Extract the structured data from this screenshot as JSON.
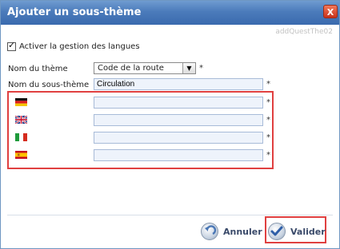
{
  "dialog": {
    "title": "Ajouter un sous-thème",
    "close_label": "X",
    "module_id": "addQuestThe02"
  },
  "form": {
    "language_toggle": {
      "label": "Activer la gestion des langues",
      "checked": true
    },
    "theme": {
      "label": "Nom du thème",
      "value": "Code de la route",
      "required_mark": "*"
    },
    "subtheme": {
      "label": "Nom du sous-thème",
      "value": "Circulation",
      "required_mark": "*"
    },
    "translations": [
      {
        "flag": "german-flag-icon",
        "value": "",
        "required_mark": "*"
      },
      {
        "flag": "uk-flag-icon",
        "value": "",
        "required_mark": "*"
      },
      {
        "flag": "italian-flag-icon",
        "value": "",
        "required_mark": "*"
      },
      {
        "flag": "spanish-flag-icon",
        "value": "",
        "required_mark": "*"
      }
    ]
  },
  "footer": {
    "cancel_label": "Annuler",
    "submit_label": "Valider"
  },
  "colors": {
    "titlebar": "#4b7bbb",
    "highlight": "#e04040",
    "input_bg": "#eef3fb"
  }
}
